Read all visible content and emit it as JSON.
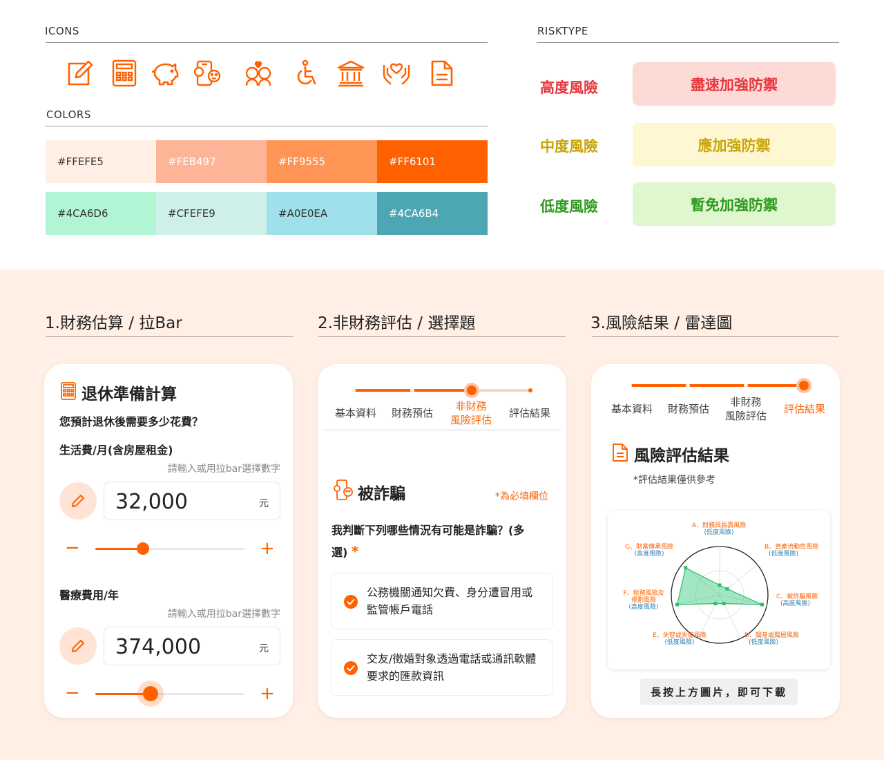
{
  "top": {
    "icons_label": "ICONS",
    "colors_label": "COLORS",
    "risktype_label": "RISKTYPE",
    "icons": [
      "edit-icon",
      "calculator-icon",
      "piggy-bank-icon",
      "phone-scam-icon",
      "family-icon",
      "wheelchair-icon",
      "bank-icon",
      "hand-heart-icon",
      "document-icon"
    ],
    "swatches_orange": [
      {
        "hex": "#FFEFE5",
        "text_color": "#333333"
      },
      {
        "hex": "#FEB497",
        "text_color": "#FFFFFF"
      },
      {
        "hex": "#FF9555",
        "text_color": "#FFFFFF"
      },
      {
        "hex": "#FF6101",
        "text_color": "#FFFFFF"
      }
    ],
    "swatches_teal": [
      {
        "hex": "#4CA6D6",
        "label": "#4CA6D6",
        "bg": "#B2F5D4",
        "text_color": "#333333"
      },
      {
        "hex": "#CFEFE9",
        "label": "#CFEFE9",
        "bg": "#CFEFE9",
        "text_color": "#333333"
      },
      {
        "hex": "#A0E0EA",
        "label": "#A0E0EA",
        "bg": "#A0E0EA",
        "text_color": "#333333"
      },
      {
        "hex": "#4CA6B4",
        "label": "#4CA6B4",
        "bg": "#4CA6B4",
        "text_color": "#FFFFFF"
      }
    ],
    "risks": [
      {
        "level": "高度風險",
        "action": "盡速加強防禦",
        "color": "#E8363C",
        "bg": "#FDDAD6"
      },
      {
        "level": "中度風險",
        "action": "應加強防禦",
        "color": "#C9A406",
        "bg": "#FEF7D2"
      },
      {
        "level": "低度風險",
        "action": "暫免加強防禦",
        "color": "#2E9A1C",
        "bg": "#DFF6CF"
      }
    ]
  },
  "steps": {
    "step1": "1.財務估算 / 拉Bar",
    "step2": "2.非財務評估 / 選擇題",
    "step3": "3.風險結果 / 雷達圖"
  },
  "card1": {
    "title": "退休準備計算",
    "question": "您預計退休後需要多少花費？",
    "fields": [
      {
        "label": "生活費/月(含房屋租金)",
        "hint": "請輸入或用拉bar選擇數字",
        "value": "32,000",
        "unit": "元",
        "slider_fraction": 0.32
      },
      {
        "label": "醫療費用/年",
        "hint": "請輸入或用拉bar選擇數字",
        "value": "374,000",
        "unit": "元",
        "slider_fraction": 0.37
      }
    ],
    "minus": "−",
    "plus": "+"
  },
  "card2": {
    "progress_fraction": 0.67,
    "tabs": [
      "基本資料",
      "財務預估",
      "非財務\n風險評估",
      "評估結果"
    ],
    "current_tab": 2,
    "section_title": "被詐騙",
    "required_note": "*為必填欄位",
    "question": "我判斷下列哪些情況有可能是詐騙？(多選)",
    "required_star": "*",
    "options": [
      "公務機關通知欠費、身分遭冒用或監管帳戶電話",
      "交友/徵婚對象透過電話或通訊軟體要求的匯款資訊"
    ]
  },
  "card3": {
    "progress_fraction": 1.0,
    "tabs": [
      "基本資料",
      "財務預估",
      "非財務\n風險評估",
      "評估結果"
    ],
    "current_tab": 3,
    "title": "風險評估結果",
    "note": "*評估結果僅供參考",
    "download": "長按上方圖片，即可下載",
    "radar": {
      "axes": [
        {
          "name": "A、財務與長壽風險",
          "level": "(低度風險)",
          "score": 0.2
        },
        {
          "name": "B、資產流動性風險",
          "level": "(低度風險)",
          "score": 0.2
        },
        {
          "name": "C、被詐騙風險",
          "level": "(高度風險)",
          "score": 0.9
        },
        {
          "name": "D、獨身或獨居風險",
          "level": "(低度風險)",
          "score": 0.2
        },
        {
          "name": "E、失智或失能風險",
          "level": "(低度風險)",
          "score": 0.2
        },
        {
          "name": "F、稅務風險及\n規劃風險",
          "level": "(高度風險)",
          "score": 0.9
        },
        {
          "name": "G、財富傳承風險",
          "level": "(高度風險)",
          "score": 0.9
        }
      ]
    }
  }
}
